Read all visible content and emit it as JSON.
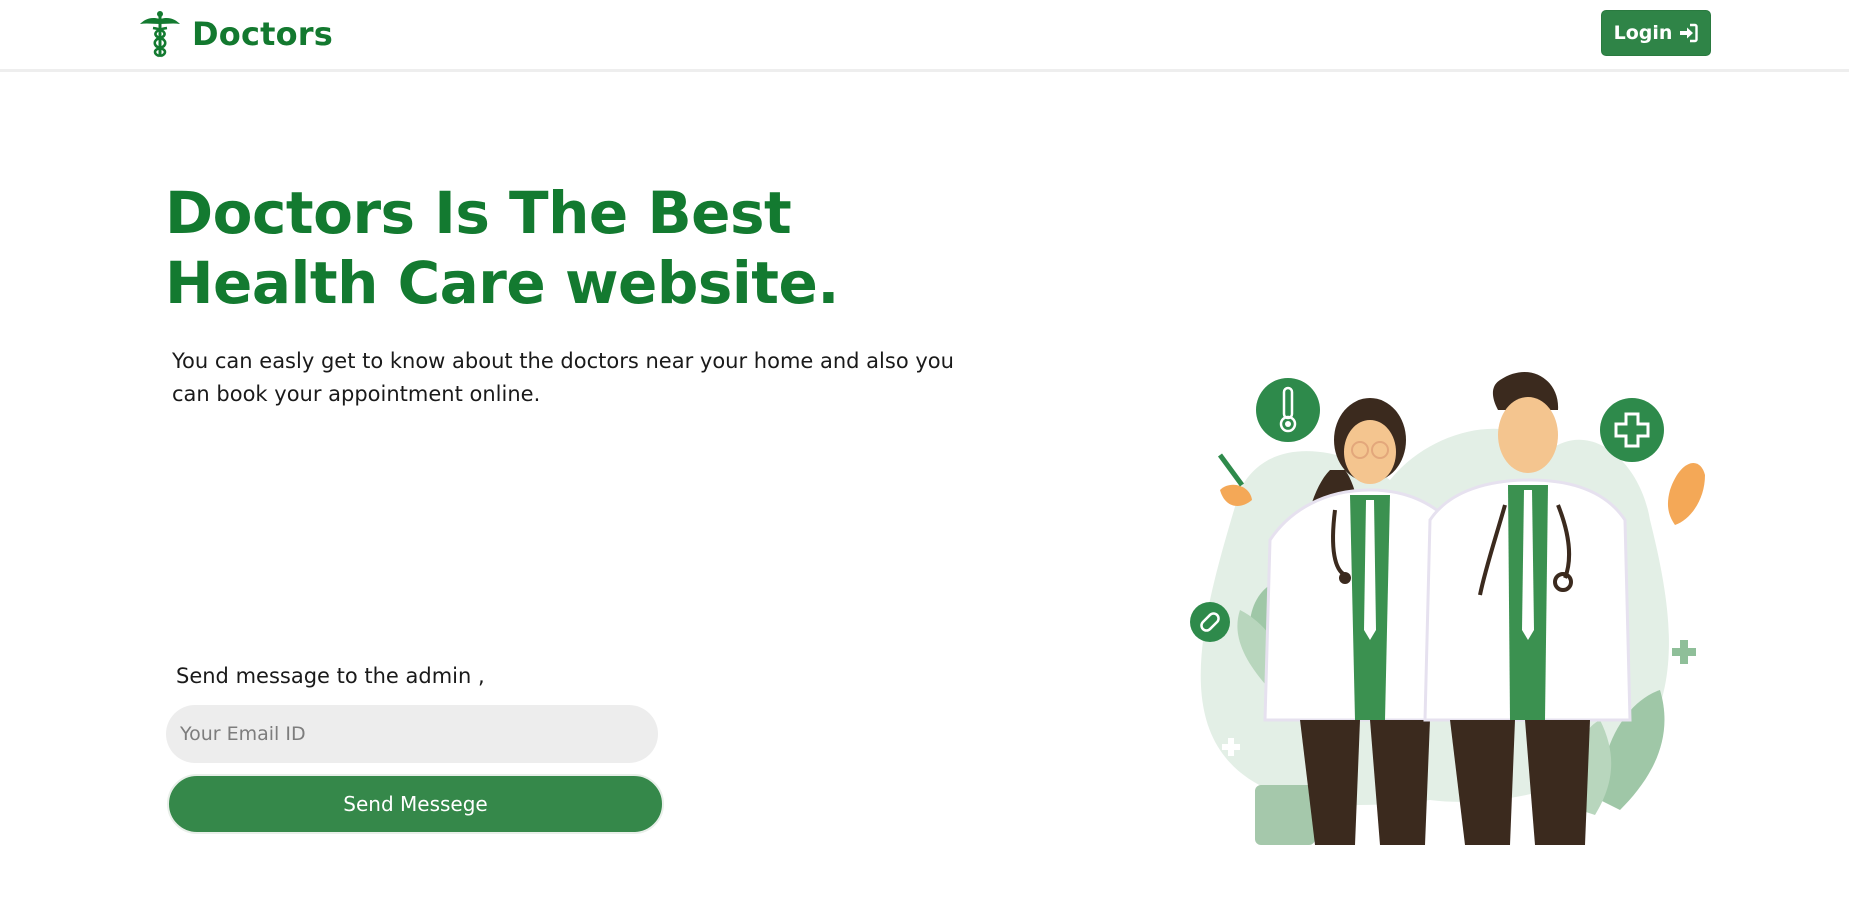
{
  "header": {
    "brand_name": "Doctors",
    "brand_icon": "caduceus-icon",
    "login_label": "Login",
    "login_icon": "sign-in-icon"
  },
  "hero": {
    "title": "Doctors Is The Best Health Care website.",
    "subtitle": "You can easly get to know about the doctors near your home and also you can book your appointment online."
  },
  "contact": {
    "label": "Send message to the admin ,",
    "email_placeholder": "Your Email ID",
    "email_value": "",
    "send_label": "Send Messege"
  },
  "illustration": {
    "icons": [
      "thermometer-icon",
      "medical-cross-icon",
      "pill-icon"
    ]
  },
  "colors": {
    "brand_green": "#137a30",
    "button_green": "#35884a",
    "login_green": "#2f8447",
    "input_bg": "#ededed"
  }
}
